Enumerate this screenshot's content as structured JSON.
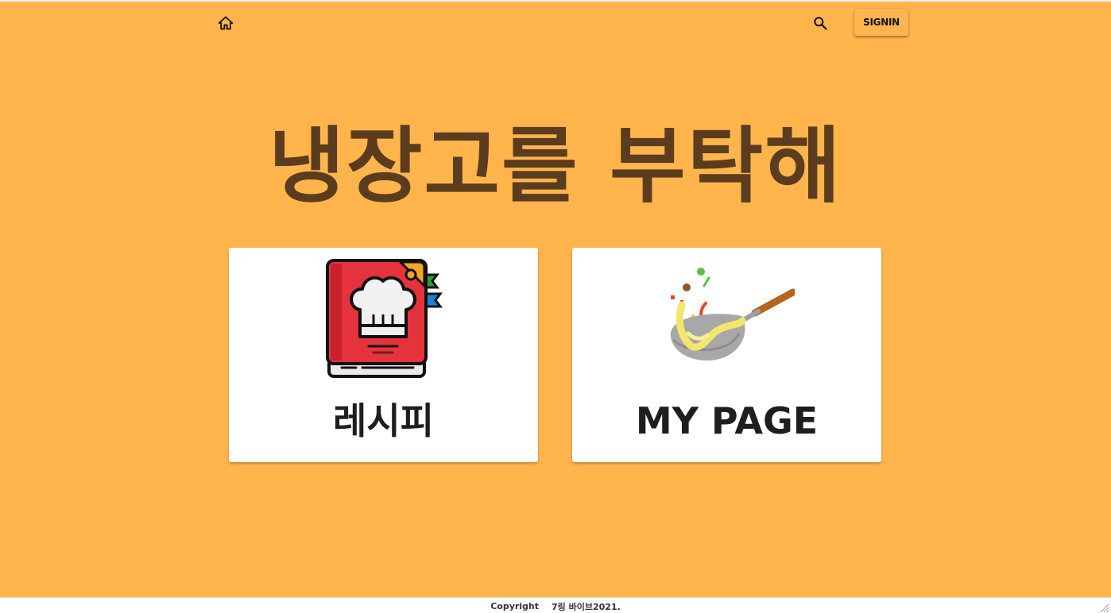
{
  "nav": {
    "home_icon": "home-icon",
    "search_icon": "search-icon",
    "signin_label": "SIGNIN"
  },
  "hero": {
    "title": "냉장고를 부탁해"
  },
  "cards": [
    {
      "label": "레시피",
      "icon": "recipe-book-icon"
    },
    {
      "label": "MY PAGE",
      "icon": "wok-icon"
    }
  ],
  "footer": {
    "copyright": "Copyright",
    "team": "7링 바이브2021."
  },
  "colors": {
    "background": "#ffb54c",
    "title": "#5c3c1e",
    "card": "#ffffff"
  }
}
